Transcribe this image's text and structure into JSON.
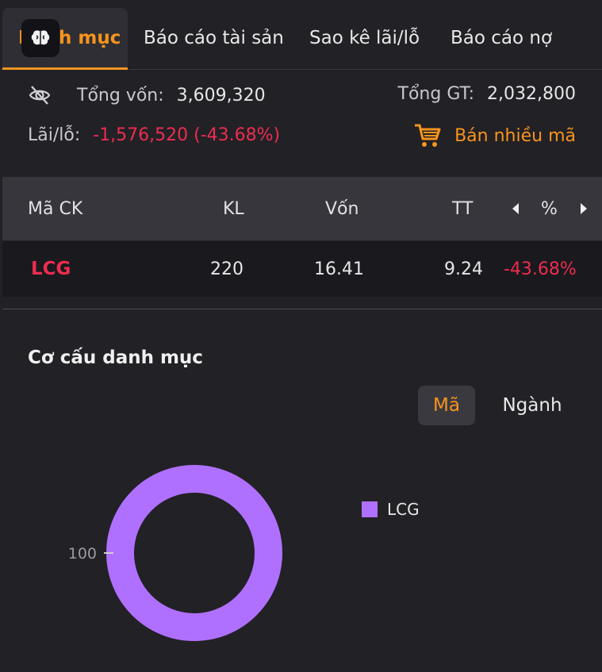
{
  "tabs": [
    {
      "label": "Danh mục",
      "active": true
    },
    {
      "label": "Báo cáo tài sản",
      "active": false
    },
    {
      "label": "Sao kê lãi/lỗ",
      "active": false
    },
    {
      "label": "Báo cáo nợ",
      "active": false
    }
  ],
  "summary": {
    "tong_von_label": "Tổng vốn:",
    "tong_von_value": "3,609,320",
    "tong_gt_label": "Tổng GT:",
    "tong_gt_value": "2,032,800",
    "lai_lo_label": "Lãi/lỗ:",
    "lai_lo_value": "-1,576,520 (-43.68%)",
    "sell_many_label": "Bán nhiều mã"
  },
  "table": {
    "headers": {
      "symbol": "Mã CK",
      "kl": "KL",
      "von": "Vốn",
      "tt": "TT",
      "pct": "%"
    },
    "rows": [
      {
        "symbol": "LCG",
        "kl": "220",
        "von": "16.41",
        "tt": "9.24",
        "pct": "-43.68%"
      }
    ]
  },
  "portfolio": {
    "title": "Cơ cấu danh mục",
    "segments": {
      "ma": "Mã",
      "nganh": "Ngành",
      "selected": "ma"
    }
  },
  "chart_data": {
    "type": "pie",
    "categories": [
      "LCG"
    ],
    "values": [
      100
    ],
    "value_labels": [
      "100"
    ],
    "colors": [
      "#b070ff"
    ],
    "legend": "right"
  },
  "colors": {
    "accent": "#f7941d",
    "negative": "#ec2d4f",
    "background": "#222126"
  }
}
